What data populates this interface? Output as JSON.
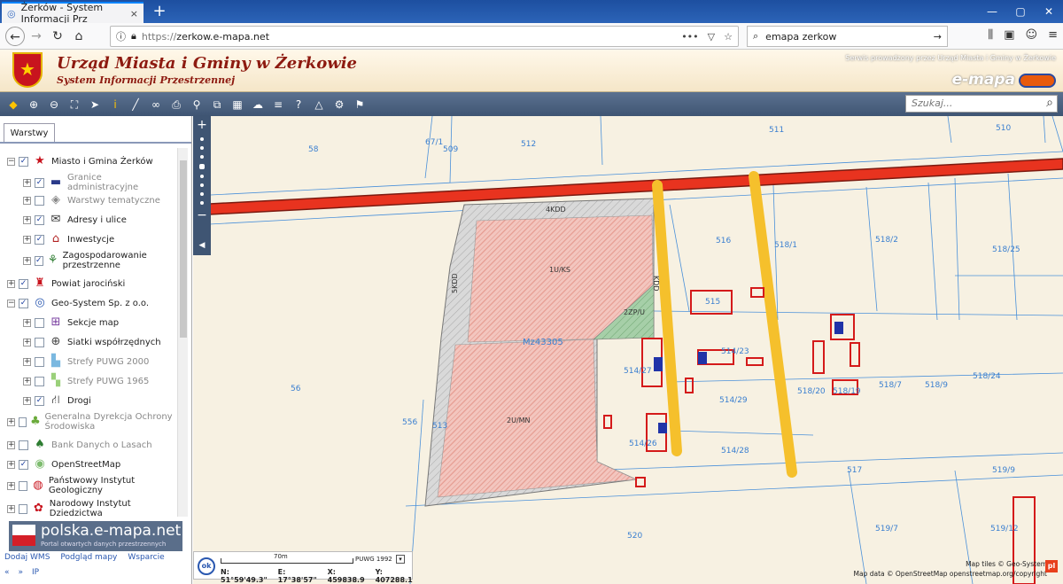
{
  "browser": {
    "tab_title": "Żerków - System Informacji Prz",
    "tab_close": "×",
    "new_tab": "+",
    "window_controls": [
      "—",
      "▢",
      "✕"
    ],
    "back": "←",
    "forward": "→",
    "reload": "↻",
    "home": "⌂",
    "url_prefix": "https://",
    "url_host": "zerkow.e-mapa.net",
    "url_menu": "•••",
    "search_value": "emapa zerkow",
    "search_go": "→"
  },
  "header": {
    "title": "Urząd Miasta i Gminy w Żerkowie",
    "subtitle": "System Informacji Przestrzennej",
    "service_note": "Serwis prowadzony przez Urząd Miasta i Gminy w Żerkowie",
    "brand": "e-mapa",
    "crest_glyph": "★"
  },
  "toolbar": {
    "tools": [
      {
        "name": "layers-tool-icon",
        "glyph": "◆",
        "gold": true
      },
      {
        "name": "zoom-in-tool-icon",
        "glyph": "⊕",
        "gold": false
      },
      {
        "name": "zoom-out-tool-icon",
        "glyph": "⊖",
        "gold": false
      },
      {
        "name": "zoom-extent-tool-icon",
        "glyph": "⛶",
        "gold": false
      },
      {
        "name": "pointer-tool-icon",
        "glyph": "➤",
        "gold": false
      },
      {
        "name": "info-tool-icon",
        "glyph": "i",
        "gold": true
      },
      {
        "name": "measure-tool-icon",
        "glyph": "╱",
        "gold": false
      },
      {
        "name": "link-tool-icon",
        "glyph": "∞",
        "gold": false
      },
      {
        "name": "print-tool-icon",
        "glyph": "⎙",
        "gold": false
      },
      {
        "name": "pin-tool-icon",
        "glyph": "⚲",
        "gold": false
      },
      {
        "name": "export-tool-icon",
        "glyph": "⧉",
        "gold": false
      },
      {
        "name": "grid-tool-icon",
        "glyph": "▦",
        "gold": false
      },
      {
        "name": "comment-tool-icon",
        "glyph": "☁",
        "gold": false
      },
      {
        "name": "hatch-tool-icon",
        "glyph": "≡",
        "gold": false
      },
      {
        "name": "help-tool-icon",
        "glyph": "?",
        "gold": false
      },
      {
        "name": "warning-tool-icon",
        "glyph": "△",
        "gold": false
      },
      {
        "name": "settings-tool-icon",
        "glyph": "⚙",
        "gold": false
      },
      {
        "name": "location-tool-icon",
        "glyph": "⚑",
        "gold": false
      }
    ],
    "search_placeholder": "Szukaj..."
  },
  "panel": {
    "tab_label": "Warstwy",
    "layers": [
      {
        "label": "Miasto i Gmina Żerków",
        "checked": true,
        "expand": "−",
        "indent": 0,
        "gray": false,
        "icon": "★",
        "icon_name": "crest-icon",
        "icon_color": "#c8141e"
      },
      {
        "label": "Granice administracyjne",
        "checked": true,
        "expand": "+",
        "indent": 1,
        "gray": true,
        "icon": "▬",
        "icon_name": "boundary-icon",
        "icon_color": "#2a3a8a"
      },
      {
        "label": "Warstwy tematyczne",
        "checked": false,
        "expand": "+",
        "indent": 1,
        "gray": true,
        "icon": "◈",
        "icon_name": "thematic-layers-icon",
        "icon_color": "#888888"
      },
      {
        "label": "Adresy i ulice",
        "checked": true,
        "expand": "+",
        "indent": 1,
        "gray": false,
        "icon": "✉",
        "icon_name": "envelope-icon",
        "icon_color": "#333333"
      },
      {
        "label": "Inwestycje",
        "checked": true,
        "expand": "+",
        "indent": 1,
        "gray": false,
        "icon": "⌂",
        "icon_name": "investment-icon",
        "icon_color": "#b22222"
      },
      {
        "label": "Zagospodarowanie przestrzenne",
        "checked": true,
        "expand": "+",
        "indent": 1,
        "gray": false,
        "icon": "⚘",
        "icon_name": "spatial-plan-icon",
        "icon_color": "#2e7d32"
      },
      {
        "label": "Powiat jarociński",
        "checked": true,
        "expand": "+",
        "indent": 0,
        "gray": false,
        "icon": "♜",
        "icon_name": "county-crest-icon",
        "icon_color": "#c8141e"
      },
      {
        "label": "Geo-System Sp. z o.o.",
        "checked": true,
        "expand": "−",
        "indent": 0,
        "gray": false,
        "icon": "◎",
        "icon_name": "geosystem-icon",
        "icon_color": "#2a58b0"
      },
      {
        "label": "Sekcje map",
        "checked": false,
        "expand": "+",
        "indent": 1,
        "gray": false,
        "icon": "⊞",
        "icon_name": "map-sections-icon",
        "icon_color": "#7a3fa0"
      },
      {
        "label": "Siatki współrzędnych",
        "checked": false,
        "expand": "+",
        "indent": 1,
        "gray": false,
        "icon": "⊕",
        "icon_name": "grid-globe-icon",
        "icon_color": "#444444"
      },
      {
        "label": "Strefy PUWG 2000",
        "checked": false,
        "expand": "+",
        "indent": 1,
        "gray": true,
        "icon": "▙",
        "icon_name": "zones-2000-icon",
        "icon_color": "#7ab8e0"
      },
      {
        "label": "Strefy PUWG 1965",
        "checked": false,
        "expand": "+",
        "indent": 1,
        "gray": true,
        "icon": "▚",
        "icon_name": "zones-1965-icon",
        "icon_color": "#9ad07a"
      },
      {
        "label": "Drogi",
        "checked": true,
        "expand": "+",
        "indent": 1,
        "gray": false,
        "icon": "⛙",
        "icon_name": "road-icon",
        "icon_color": "#222222"
      },
      {
        "label": "Generalna Dyrekcja Ochrony Środowiska",
        "checked": false,
        "expand": "+",
        "indent": 0,
        "gray": true,
        "icon": "♣",
        "icon_name": "environment-icon",
        "icon_color": "#6aaa3a"
      },
      {
        "label": "Bank Danych o Lasach",
        "checked": false,
        "expand": "+",
        "indent": 0,
        "gray": true,
        "icon": "♠",
        "icon_name": "forest-icon",
        "icon_color": "#2e7d32"
      },
      {
        "label": "OpenStreetMap",
        "checked": true,
        "expand": "+",
        "indent": 0,
        "gray": false,
        "icon": "◉",
        "icon_name": "osm-icon",
        "icon_color": "#7ebc6f"
      },
      {
        "label": "Państwowy Instytut Geologiczny",
        "checked": false,
        "expand": "+",
        "indent": 0,
        "gray": false,
        "icon": "◍",
        "icon_name": "geology-icon",
        "icon_color": "#c8141e"
      },
      {
        "label": "Narodowy Instytut Dziedzictwa",
        "checked": false,
        "expand": "+",
        "indent": 0,
        "gray": false,
        "icon": "✿",
        "icon_name": "heritage-icon",
        "icon_color": "#c8141e"
      }
    ],
    "promo_title": "polska.e-mapa.net",
    "promo_sub": "Portal otwartych danych przestrzennych",
    "links": [
      "Dodaj WMS",
      "Podgląd mapy",
      "Wsparcie"
    ],
    "bottom": [
      "«",
      "»",
      "IP"
    ]
  },
  "map": {
    "zoom_in": "+",
    "zoom_out": "−",
    "collapse": "◀",
    "parcels": [
      "58",
      "67/1",
      "509",
      "512",
      "511",
      "510",
      "516",
      "518/1",
      "518/2",
      "518/25",
      "515",
      "514/23",
      "514/27",
      "514/29",
      "514/28",
      "514/26",
      "513",
      "556",
      "56",
      "518/20",
      "518/19",
      "518/7",
      "518/9",
      "518/24",
      "517",
      "519/9",
      "519/7",
      "519/12",
      "520"
    ],
    "zones": [
      "4KDD",
      "1U/KS",
      "2ZP/U",
      "2U/MN",
      "5KDD",
      "KDD"
    ],
    "watermark": "Mz43305",
    "scale_label": "70m",
    "crs": "PUWG 1992",
    "coord_n": "N: 51°59'49.3\"",
    "coord_e": "E: 17°38'57\"",
    "coord_x": "X: 459838.9",
    "coord_y": "Y: 407288.1",
    "ok": "ok",
    "attribution_1": "Map tiles © Geo-System",
    "attribution_2": "Map data © OpenStreetMap openstreetmap.org/copyright",
    "badge": "pl"
  }
}
